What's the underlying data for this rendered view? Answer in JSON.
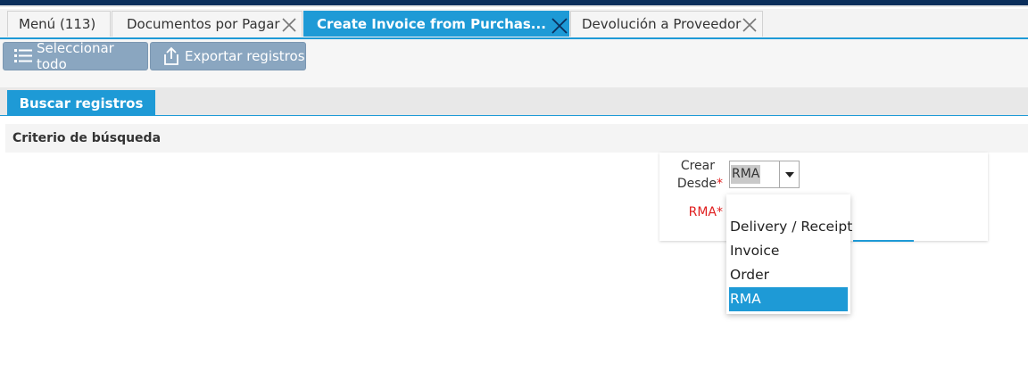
{
  "tabs": [
    {
      "label": "Menú (113)",
      "closable": false,
      "active": false
    },
    {
      "label": "Documentos por Pagar",
      "closable": true,
      "active": false
    },
    {
      "label": "Create Invoice from Purchas...",
      "closable": true,
      "active": true
    },
    {
      "label": "Devolución a Proveedor",
      "closable": true,
      "active": false
    }
  ],
  "toolbar": {
    "select_all_label": "Seleccionar todo",
    "select_all_icon": "list-icon",
    "export_label": "Exportar registros",
    "export_icon": "export-icon"
  },
  "search_tab_label": "Buscar registros",
  "criteria_title": "Criterio de búsqueda",
  "form": {
    "create_from_label_line1": "Crear",
    "create_from_label_line2": "Desde",
    "required_mark": "*",
    "create_from_value": "RMA",
    "rma_label": "RMA"
  },
  "dropdown": {
    "options": [
      "",
      "Delivery / Receipt",
      "Invoice",
      "Order",
      "RMA"
    ],
    "selected": "RMA"
  },
  "colors": {
    "accent": "#1e9ad6",
    "toolbar_button": "#8aa6c0",
    "header_bar": "#0b2f5c",
    "required": "#e02020"
  }
}
